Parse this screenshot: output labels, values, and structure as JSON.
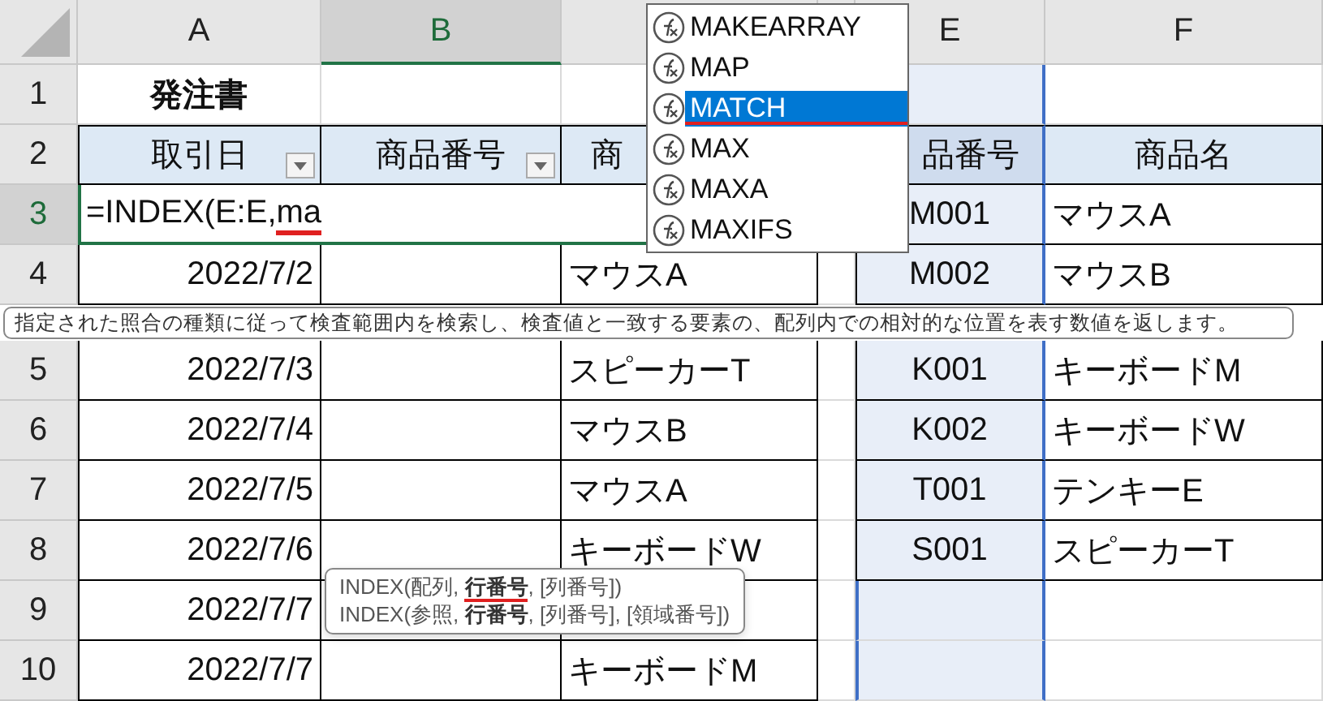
{
  "columns": [
    {
      "label": "A",
      "selected": false,
      "referenced": false
    },
    {
      "label": "B",
      "selected": true,
      "referenced": false
    },
    {
      "selected": false,
      "referenced": false
    },
    {
      "selected": false,
      "referenced": false
    },
    {
      "label": "E",
      "selected": false,
      "referenced": true
    },
    {
      "label": "F",
      "selected": false,
      "referenced": false
    }
  ],
  "rows": [
    {
      "header": "1",
      "selected": false,
      "kind": "title",
      "a": "発注書"
    },
    {
      "header": "2",
      "selected": false,
      "kind": "header",
      "a": "取引日",
      "a_filter": true,
      "b": "商品番号",
      "b_filter": true,
      "c": "商",
      "e": "品番号",
      "f": "商品名"
    },
    {
      "header": "3",
      "selected": true,
      "kind": "data",
      "editing": {
        "text": "=INDEX(E:E,",
        "typed": "ma"
      },
      "e": "M001",
      "f": "マウスA"
    },
    {
      "header": "4",
      "selected": false,
      "kind": "data",
      "a": "2022/7/2",
      "c": "マウスA",
      "e": "M002",
      "f": "マウスB"
    },
    {
      "header": "5",
      "selected": false,
      "kind": "data",
      "a": "2022/7/3",
      "c": "スピーカーT",
      "e": "K001",
      "f": "キーボードM"
    },
    {
      "header": "6",
      "selected": false,
      "kind": "data",
      "a": "2022/7/4",
      "c": "マウスB",
      "e": "K002",
      "f": "キーボードW"
    },
    {
      "header": "7",
      "selected": false,
      "kind": "data",
      "a": "2022/7/5",
      "c": "マウスA",
      "e": "T001",
      "f": "テンキーE"
    },
    {
      "header": "8",
      "selected": false,
      "kind": "data",
      "a": "2022/7/6",
      "c": "キーボードW",
      "e": "S001",
      "f": "スピーカーT"
    },
    {
      "header": "9",
      "selected": false,
      "kind": "data",
      "a": "2022/7/7"
    },
    {
      "header": "10",
      "selected": false,
      "kind": "data",
      "a": "2022/7/7",
      "c": "キーボードM"
    }
  ],
  "autocomplete": [
    {
      "label": "MAKEARRAY",
      "selected": false,
      "underlined": false
    },
    {
      "label": "MAP",
      "selected": false,
      "underlined": false
    },
    {
      "label": "MATCH",
      "selected": true,
      "underlined": true
    },
    {
      "label": "MAX",
      "selected": false,
      "underlined": false
    },
    {
      "label": "MAXA",
      "selected": false,
      "underlined": false
    },
    {
      "label": "MAXIFS",
      "selected": false,
      "underlined": false
    }
  ],
  "function_tooltip": "指定された照合の種類に従って検査範囲内を検索し、検査値と一致する要素の、配列内での相対的な位置を表す数値を返します。",
  "syntax_tooltip": [
    {
      "text": "INDEX(配列, **行番号**, [列番号])",
      "underlined": true
    },
    {
      "text": "INDEX(参照, **行番号**, [列番号], [領域番号])",
      "underlined": false
    }
  ]
}
